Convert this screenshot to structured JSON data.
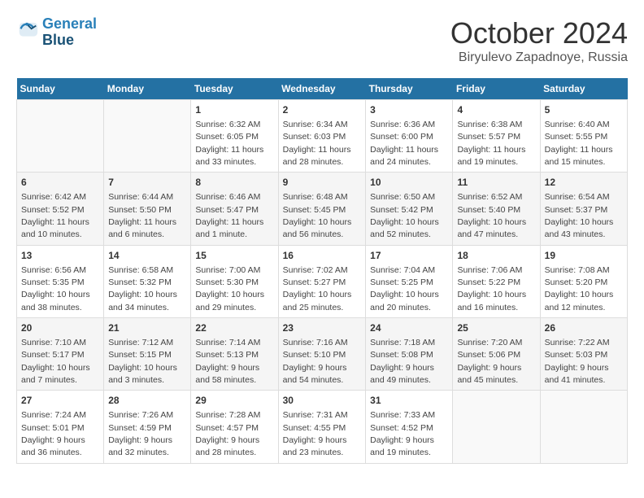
{
  "header": {
    "logo_line1": "General",
    "logo_line2": "Blue",
    "month": "October 2024",
    "location": "Biryulevo Zapadnoye, Russia"
  },
  "weekdays": [
    "Sunday",
    "Monday",
    "Tuesday",
    "Wednesday",
    "Thursday",
    "Friday",
    "Saturday"
  ],
  "weeks": [
    [
      {
        "day": "",
        "details": ""
      },
      {
        "day": "",
        "details": ""
      },
      {
        "day": "1",
        "details": "Sunrise: 6:32 AM\nSunset: 6:05 PM\nDaylight: 11 hours and 33 minutes."
      },
      {
        "day": "2",
        "details": "Sunrise: 6:34 AM\nSunset: 6:03 PM\nDaylight: 11 hours and 28 minutes."
      },
      {
        "day": "3",
        "details": "Sunrise: 6:36 AM\nSunset: 6:00 PM\nDaylight: 11 hours and 24 minutes."
      },
      {
        "day": "4",
        "details": "Sunrise: 6:38 AM\nSunset: 5:57 PM\nDaylight: 11 hours and 19 minutes."
      },
      {
        "day": "5",
        "details": "Sunrise: 6:40 AM\nSunset: 5:55 PM\nDaylight: 11 hours and 15 minutes."
      }
    ],
    [
      {
        "day": "6",
        "details": "Sunrise: 6:42 AM\nSunset: 5:52 PM\nDaylight: 11 hours and 10 minutes."
      },
      {
        "day": "7",
        "details": "Sunrise: 6:44 AM\nSunset: 5:50 PM\nDaylight: 11 hours and 6 minutes."
      },
      {
        "day": "8",
        "details": "Sunrise: 6:46 AM\nSunset: 5:47 PM\nDaylight: 11 hours and 1 minute."
      },
      {
        "day": "9",
        "details": "Sunrise: 6:48 AM\nSunset: 5:45 PM\nDaylight: 10 hours and 56 minutes."
      },
      {
        "day": "10",
        "details": "Sunrise: 6:50 AM\nSunset: 5:42 PM\nDaylight: 10 hours and 52 minutes."
      },
      {
        "day": "11",
        "details": "Sunrise: 6:52 AM\nSunset: 5:40 PM\nDaylight: 10 hours and 47 minutes."
      },
      {
        "day": "12",
        "details": "Sunrise: 6:54 AM\nSunset: 5:37 PM\nDaylight: 10 hours and 43 minutes."
      }
    ],
    [
      {
        "day": "13",
        "details": "Sunrise: 6:56 AM\nSunset: 5:35 PM\nDaylight: 10 hours and 38 minutes."
      },
      {
        "day": "14",
        "details": "Sunrise: 6:58 AM\nSunset: 5:32 PM\nDaylight: 10 hours and 34 minutes."
      },
      {
        "day": "15",
        "details": "Sunrise: 7:00 AM\nSunset: 5:30 PM\nDaylight: 10 hours and 29 minutes."
      },
      {
        "day": "16",
        "details": "Sunrise: 7:02 AM\nSunset: 5:27 PM\nDaylight: 10 hours and 25 minutes."
      },
      {
        "day": "17",
        "details": "Sunrise: 7:04 AM\nSunset: 5:25 PM\nDaylight: 10 hours and 20 minutes."
      },
      {
        "day": "18",
        "details": "Sunrise: 7:06 AM\nSunset: 5:22 PM\nDaylight: 10 hours and 16 minutes."
      },
      {
        "day": "19",
        "details": "Sunrise: 7:08 AM\nSunset: 5:20 PM\nDaylight: 10 hours and 12 minutes."
      }
    ],
    [
      {
        "day": "20",
        "details": "Sunrise: 7:10 AM\nSunset: 5:17 PM\nDaylight: 10 hours and 7 minutes."
      },
      {
        "day": "21",
        "details": "Sunrise: 7:12 AM\nSunset: 5:15 PM\nDaylight: 10 hours and 3 minutes."
      },
      {
        "day": "22",
        "details": "Sunrise: 7:14 AM\nSunset: 5:13 PM\nDaylight: 9 hours and 58 minutes."
      },
      {
        "day": "23",
        "details": "Sunrise: 7:16 AM\nSunset: 5:10 PM\nDaylight: 9 hours and 54 minutes."
      },
      {
        "day": "24",
        "details": "Sunrise: 7:18 AM\nSunset: 5:08 PM\nDaylight: 9 hours and 49 minutes."
      },
      {
        "day": "25",
        "details": "Sunrise: 7:20 AM\nSunset: 5:06 PM\nDaylight: 9 hours and 45 minutes."
      },
      {
        "day": "26",
        "details": "Sunrise: 7:22 AM\nSunset: 5:03 PM\nDaylight: 9 hours and 41 minutes."
      }
    ],
    [
      {
        "day": "27",
        "details": "Sunrise: 7:24 AM\nSunset: 5:01 PM\nDaylight: 9 hours and 36 minutes."
      },
      {
        "day": "28",
        "details": "Sunrise: 7:26 AM\nSunset: 4:59 PM\nDaylight: 9 hours and 32 minutes."
      },
      {
        "day": "29",
        "details": "Sunrise: 7:28 AM\nSunset: 4:57 PM\nDaylight: 9 hours and 28 minutes."
      },
      {
        "day": "30",
        "details": "Sunrise: 7:31 AM\nSunset: 4:55 PM\nDaylight: 9 hours and 23 minutes."
      },
      {
        "day": "31",
        "details": "Sunrise: 7:33 AM\nSunset: 4:52 PM\nDaylight: 9 hours and 19 minutes."
      },
      {
        "day": "",
        "details": ""
      },
      {
        "day": "",
        "details": ""
      }
    ]
  ]
}
